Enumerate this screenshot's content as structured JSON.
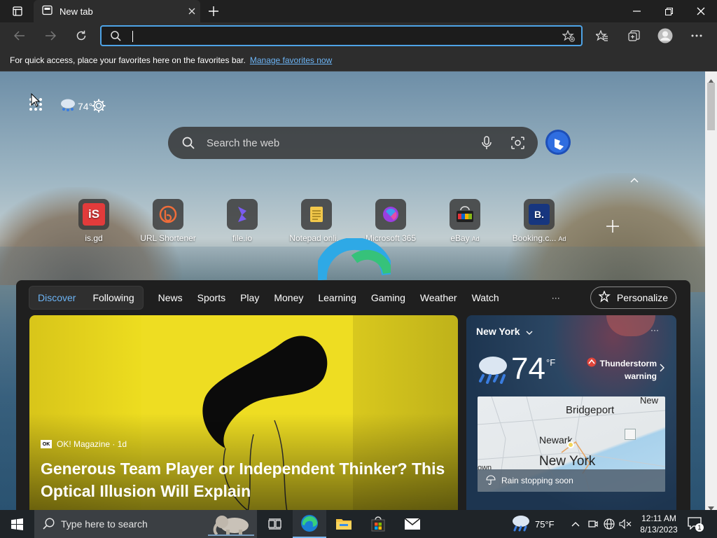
{
  "browser": {
    "tab_title": "New tab",
    "address_value": "",
    "favorites_bar_text": "For quick access, place your favorites here on the favorites bar.",
    "favorites_bar_link": "Manage favorites now"
  },
  "newtab": {
    "weather_badge": "74°",
    "search_placeholder": "Search the web",
    "quick_links": [
      {
        "label": "is.gd",
        "ad": ""
      },
      {
        "label": "URL Shortener",
        "ad": ""
      },
      {
        "label": "file.io",
        "ad": ""
      },
      {
        "label": "Notepad onli...",
        "ad": ""
      },
      {
        "label": "Microsoft 365",
        "ad": ""
      },
      {
        "label": "eBay",
        "ad": "Ad"
      },
      {
        "label": "Booking.c...",
        "ad": "Ad"
      }
    ],
    "tile_texts": {
      "isgd": "iS",
      "booking": "B."
    }
  },
  "feed": {
    "tabs": [
      "Discover",
      "Following"
    ],
    "categories": [
      "News",
      "Sports",
      "Play",
      "Money",
      "Learning",
      "Gaming",
      "Weather",
      "Watch"
    ],
    "more_label": "···",
    "personalize_label": "Personalize",
    "story": {
      "source": "OK! Magazine · 1d",
      "source_logo": "OK",
      "headline_line1": "Generous Team Player or Independent Thinker? This",
      "headline_line2": "Optical Illusion Will Explain"
    },
    "weather": {
      "location": "New York",
      "temperature": "74",
      "unit": "°F",
      "alert_line1": "Thunderstorm",
      "alert_line2": "warning",
      "map_labels": [
        "Bridgeport",
        "New",
        "Newark",
        "New York",
        "own"
      ],
      "forecast": "Rain stopping soon",
      "more_label": "···"
    }
  },
  "taskbar": {
    "search_placeholder": "Type here to search",
    "weather_temp": "75°F",
    "time": "12:11 AM",
    "date": "8/13/2023",
    "notification_count": "1"
  },
  "colors": {
    "accent": "#4ea3e6",
    "link": "#6cb4f5",
    "story_yellow": "#f0e020",
    "alert_red": "#e0443a"
  }
}
